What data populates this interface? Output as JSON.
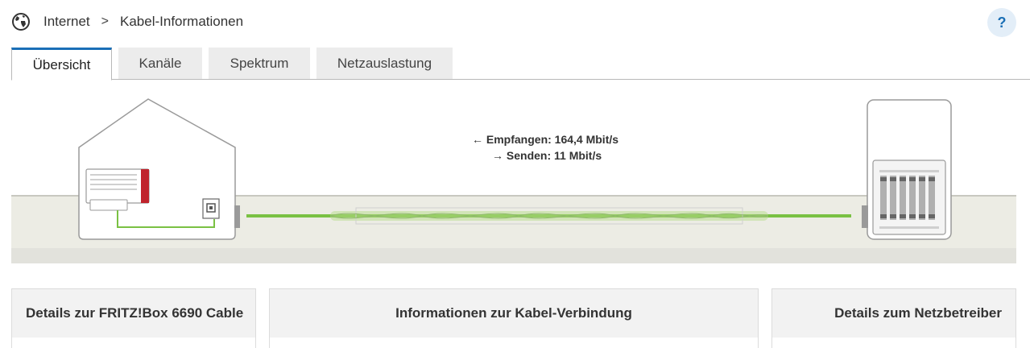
{
  "breadcrumb": {
    "icon": "globe-icon",
    "root": "Internet",
    "separator": ">",
    "current": "Kabel-Informationen"
  },
  "help": {
    "label": "?"
  },
  "tabs": [
    {
      "label": "Übersicht",
      "active": true
    },
    {
      "label": "Kanäle",
      "active": false
    },
    {
      "label": "Spektrum",
      "active": false
    },
    {
      "label": "Netzauslastung",
      "active": false
    }
  ],
  "diagram": {
    "receive": "← Empfangen: 164,4 Mbit/s",
    "send": "→ Senden: 11 Mbit/s",
    "cable_color": "#7ac143",
    "router_accent": "#c0232c"
  },
  "panels": {
    "fritzbox": {
      "title": "Details zur FRITZ!Box 6690 Cable"
    },
    "connection": {
      "title": "Informationen zur Kabel-Verbindung"
    },
    "provider": {
      "title": "Details zum Netzbetreiber"
    }
  }
}
